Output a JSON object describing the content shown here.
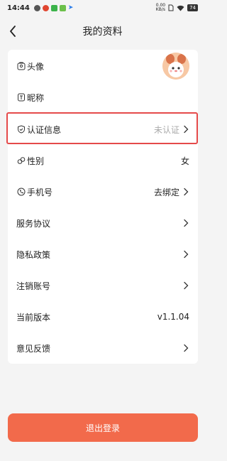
{
  "status_bar": {
    "time": "14:44",
    "net_speed_value": "0.00",
    "net_speed_unit": "KB/s",
    "battery": "74"
  },
  "header": {
    "title": "我的资料"
  },
  "profile_items": [
    {
      "label": "头像",
      "icon": "avatar-frame-icon",
      "value": ""
    },
    {
      "label": "昵称",
      "icon": "nickname-tag-icon",
      "value": ""
    },
    {
      "label": "认证信息",
      "icon": "shield-check-icon",
      "value": "未认证"
    },
    {
      "label": "性别",
      "icon": "gender-icon",
      "value": "女"
    },
    {
      "label": "手机号",
      "icon": "phone-chat-icon",
      "value": "去绑定"
    },
    {
      "label": "服务协议",
      "value": ""
    },
    {
      "label": "隐私政策",
      "value": ""
    },
    {
      "label": "注销账号",
      "value": ""
    },
    {
      "label": "当前版本",
      "value": "v1.1.04"
    },
    {
      "label": "意见反馈",
      "value": ""
    }
  ],
  "logout_label": "退出登录",
  "colors": {
    "accent": "#f26a4b",
    "highlight": "#e54a4a",
    "muted_text": "#aaaaaa",
    "background": "#f4f4f4"
  }
}
